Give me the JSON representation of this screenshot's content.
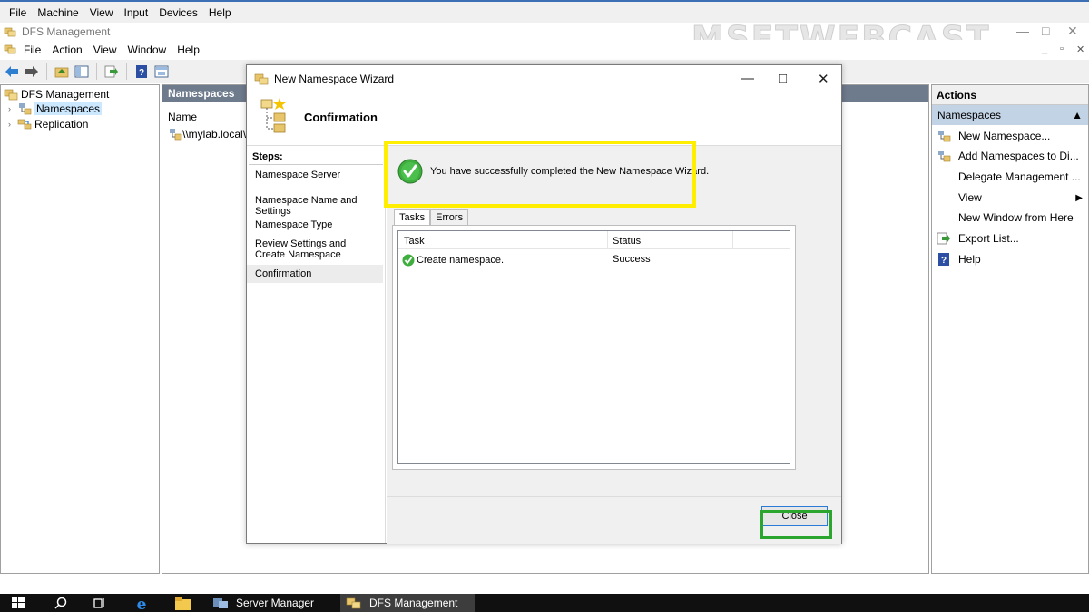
{
  "vm_menu": [
    "File",
    "Machine",
    "View",
    "Input",
    "Devices",
    "Help"
  ],
  "mmc": {
    "title": "DFS Management",
    "watermark": "MSFTWEBCAST",
    "menu": [
      "File",
      "Action",
      "View",
      "Window",
      "Help"
    ],
    "window_controls": {
      "minimize": "—",
      "restore": "□",
      "close": "✕"
    },
    "inner_controls": {
      "minimize": "_",
      "restore": "▫",
      "close": "✕"
    }
  },
  "toolbar": {
    "icons": [
      "back-arrow-icon",
      "forward-arrow-icon",
      "up-folder-icon",
      "show-hide-tree-icon",
      "export-icon",
      "help-icon",
      "properties-icon"
    ]
  },
  "tree": {
    "root": "DFS Management",
    "items": [
      {
        "label": "Namespaces",
        "selected": true
      },
      {
        "label": "Replication",
        "selected": false
      }
    ]
  },
  "center": {
    "header": "Namespaces",
    "column": "Name",
    "row": "\\\\mylab.local\\s"
  },
  "actions": {
    "header": "Actions",
    "section": "Namespaces",
    "items": [
      {
        "label": "New Namespace...",
        "icon": "new-namespace-icon"
      },
      {
        "label": "Add Namespaces to Di...",
        "icon": "add-namespace-icon"
      },
      {
        "label": "Delegate Management ...",
        "icon": ""
      },
      {
        "label": "View",
        "icon": "",
        "submenu": true
      },
      {
        "label": "New Window from Here",
        "icon": ""
      },
      {
        "label": "Export List...",
        "icon": "export-list-icon"
      },
      {
        "label": "Help",
        "icon": "help-icon"
      }
    ]
  },
  "wizard": {
    "title": "New Namespace Wizard",
    "heading": "Confirmation",
    "window_controls": {
      "minimize": "—",
      "maximize": "□",
      "close": "✕"
    },
    "steps_label": "Steps:",
    "steps": [
      "Namespace Server",
      "Namespace Name and Settings",
      "Namespace Type",
      "Review Settings and Create Namespace",
      "Confirmation"
    ],
    "active_step": 4,
    "success_message": "You have successfully completed the New Namespace Wizard.",
    "tabs": [
      "Tasks",
      "Errors"
    ],
    "grid": {
      "columns": [
        "Task",
        "Status"
      ],
      "rows": [
        {
          "task": "Create namespace.",
          "status": "Success"
        }
      ]
    },
    "close_label": "Close"
  },
  "taskbar": {
    "icons": [
      "windows-start-icon",
      "search-icon",
      "task-view-icon",
      "internet-explorer-icon",
      "file-explorer-icon"
    ],
    "apps": [
      {
        "label": "Server Manager",
        "active": false
      },
      {
        "label": "DFS Management",
        "active": true
      }
    ]
  },
  "colors": {
    "selection": "#cce8ff",
    "center_header": "#6e7b8c",
    "actions_section": "#c3d3e6",
    "highlight_yellow": "#ffee00",
    "highlight_green": "#2aa52e",
    "taskbar": "#101010"
  }
}
